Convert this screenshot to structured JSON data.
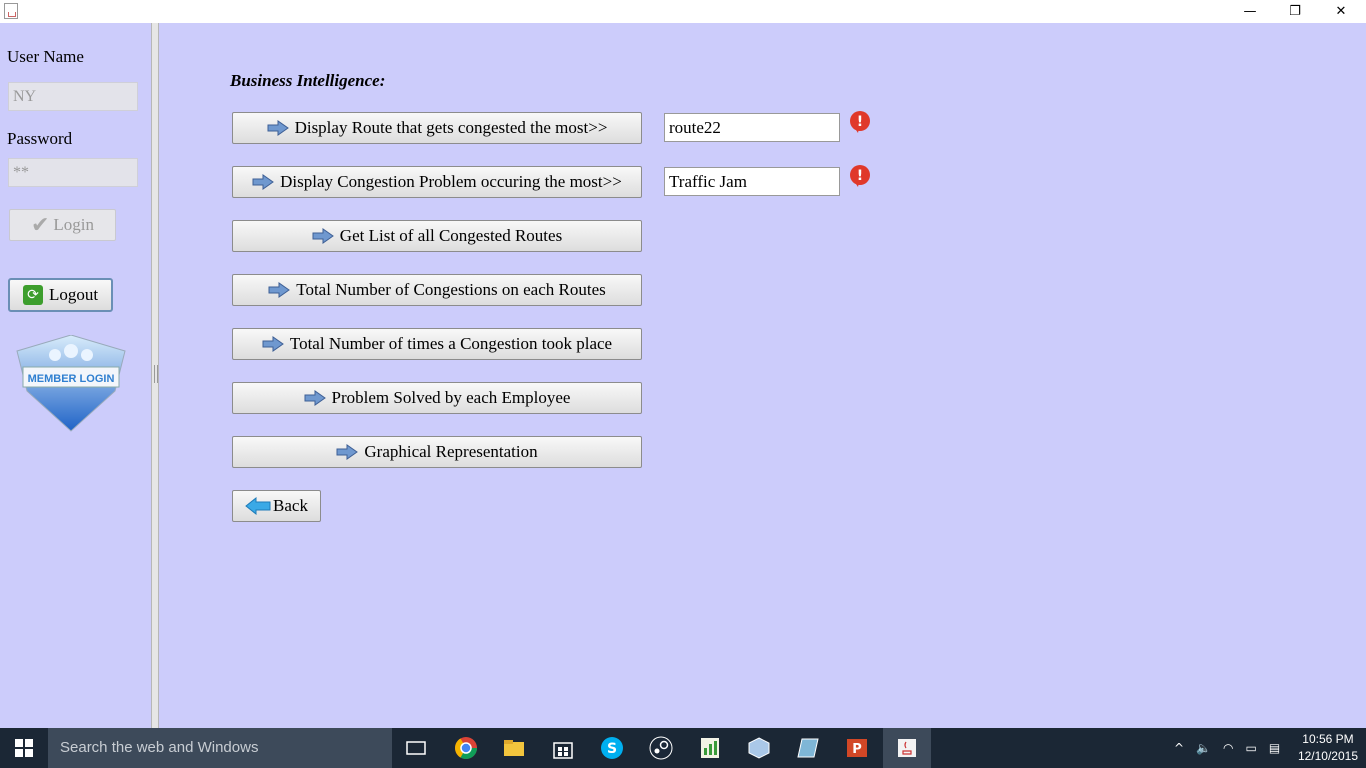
{
  "window": {
    "minimize": "—",
    "restore": "❐",
    "close": "✕"
  },
  "login": {
    "username_label": "User Name",
    "username_value": "NY",
    "password_label": "Password",
    "password_value": "**",
    "login_label": "Login",
    "logout_label": "Logout",
    "member_badge": "MEMBER LOGIN"
  },
  "main": {
    "heading": "Business Intelligence:",
    "buttons": [
      "Display Route that gets congested the most>>",
      "Display Congestion Problem occuring the most>>",
      "Get List of all Congested Routes",
      "Total Number of Congestions on each Routes",
      "Total Number of times a Congestion took place",
      "Problem Solved by each Employee",
      "Graphical Representation"
    ],
    "back_label": "Back",
    "result_route": "route22",
    "result_problem": "Traffic Jam"
  },
  "taskbar": {
    "search_placeholder": "Search the web and Windows",
    "time": "10:56 PM",
    "date": "12/10/2015"
  }
}
